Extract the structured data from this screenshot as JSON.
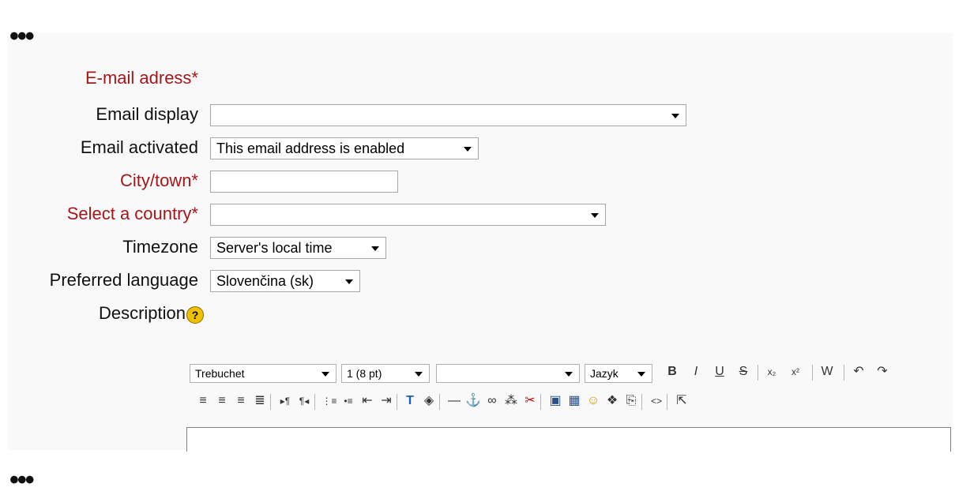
{
  "ellipsis_top": "•••",
  "ellipsis_bottom": "•••",
  "form": {
    "email_label": "E-mail adress*",
    "email_display_label": "Email display",
    "email_display_value": "",
    "email_activated_label": "Email activated",
    "email_activated_value": "This email address is enabled",
    "city_label": "City/town*",
    "city_value": "",
    "country_label": "Select a country*",
    "country_value": "",
    "timezone_label": "Timezone",
    "timezone_value": "Server's local time",
    "language_label": "Preferred language",
    "language_value": "Slovenčina (sk)",
    "description_label": "Description",
    "help_icon_glyph": "?"
  },
  "editor": {
    "font_value": "Trebuchet",
    "size_value": "1 (8 pt)",
    "style_value": "",
    "lang_value": "Jazyk",
    "toolbar_row1": [
      {
        "name": "bold-icon",
        "glyph": "B"
      },
      {
        "name": "italic-icon",
        "glyph": "I"
      },
      {
        "name": "underline-icon",
        "glyph": "U"
      },
      {
        "name": "strikethrough-icon",
        "glyph": "S"
      },
      {
        "name": "subscript-icon",
        "glyph": "x₂"
      },
      {
        "name": "superscript-icon",
        "glyph": "x²"
      },
      {
        "name": "paste-word-icon",
        "glyph": "W"
      },
      {
        "name": "undo-icon",
        "glyph": "↶"
      },
      {
        "name": "redo-icon",
        "glyph": "↷"
      }
    ],
    "toolbar_row2": [
      {
        "name": "align-left-icon",
        "glyph": "≡"
      },
      {
        "name": "align-center-icon",
        "glyph": "≡"
      },
      {
        "name": "align-right-icon",
        "glyph": "≡"
      },
      {
        "name": "justify-icon",
        "glyph": "≣"
      },
      {
        "name": "ltr-icon",
        "glyph": "▸¶"
      },
      {
        "name": "rtl-icon",
        "glyph": "¶◂"
      },
      {
        "name": "ordered-list-icon",
        "glyph": "⋮≡"
      },
      {
        "name": "unordered-list-icon",
        "glyph": "•≡"
      },
      {
        "name": "outdent-icon",
        "glyph": "⇤"
      },
      {
        "name": "indent-icon",
        "glyph": "⇥"
      },
      {
        "name": "text-color-icon",
        "glyph": "T"
      },
      {
        "name": "background-color-icon",
        "glyph": "◈"
      },
      {
        "name": "horizontal-rule-icon",
        "glyph": "—"
      },
      {
        "name": "anchor-icon",
        "glyph": "⚓"
      },
      {
        "name": "link-icon",
        "glyph": "∞"
      },
      {
        "name": "unlink-icon",
        "glyph": "⁂"
      },
      {
        "name": "nolink-icon",
        "glyph": "✂"
      },
      {
        "name": "image-icon",
        "glyph": "▣"
      },
      {
        "name": "table-icon",
        "glyph": "▦"
      },
      {
        "name": "smiley-icon",
        "glyph": "☺"
      },
      {
        "name": "spellcheck-icon",
        "glyph": "❖"
      },
      {
        "name": "search-replace-icon",
        "glyph": "⎘"
      },
      {
        "name": "html-source-icon",
        "glyph": "<>"
      },
      {
        "name": "fullscreen-icon",
        "glyph": "⇱"
      }
    ]
  }
}
